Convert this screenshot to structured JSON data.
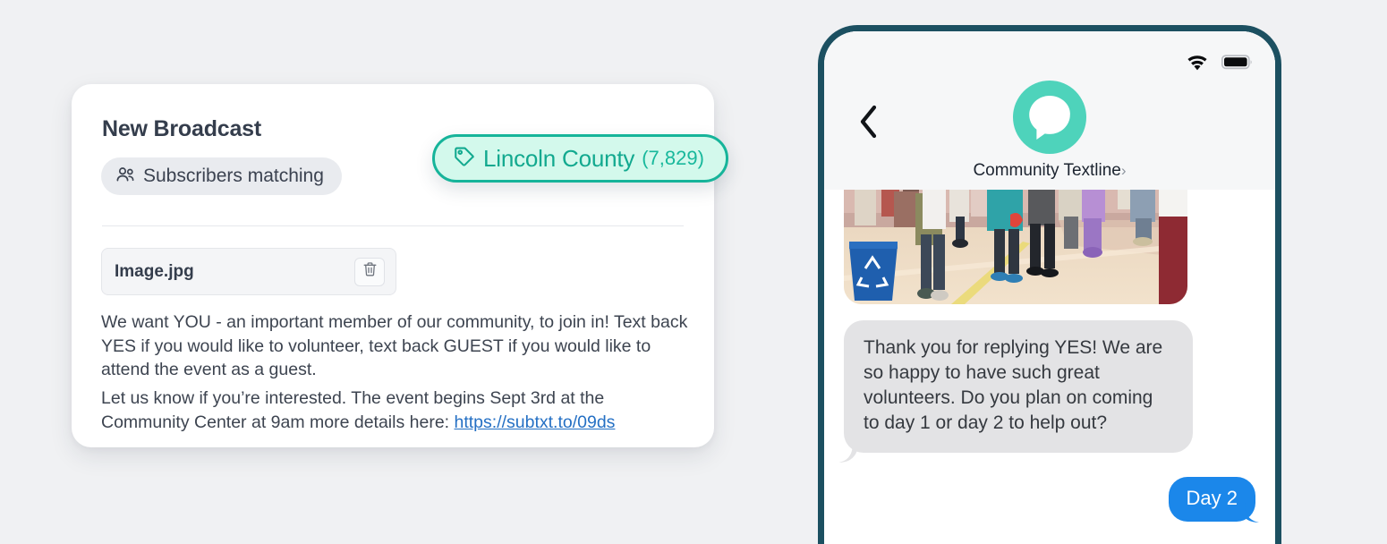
{
  "theme": {
    "page_background": "#f0f1f3",
    "accent_teal": "#16b49a",
    "phone_frame": "#1c5061",
    "imessage_blue": "#1b87ea",
    "link_blue": "#2570c4"
  },
  "broadcast": {
    "title": "New Broadcast",
    "subscribers_chip": {
      "icon": "people-group-icon",
      "label": "Subscribers matching"
    },
    "attachment": {
      "file_name": "Image.jpg",
      "delete_icon": "trash-icon"
    },
    "message_paragraphs": [
      "We want YOU - an important member of our community, to join in! Text back YES if you would like to volunteer, text back GUEST if you would like to attend the event as a guest.",
      "Let us know if you’re interested. The event begins Sept 3rd at the Community Center at 9am more details here: "
    ],
    "message_link": "https://subtxt.to/09ds"
  },
  "tag_pill": {
    "icon": "tag-icon",
    "name": "Lincoln County",
    "count": "(7,829)"
  },
  "phone": {
    "status": {
      "wifi_icon": "wifi-icon",
      "battery_icon": "battery-full-icon"
    },
    "back_icon": "chevron-left-icon",
    "avatar_icon": "speech-bubble-avatar-icon",
    "thread_name": "Community Textline",
    "thread_chevron": "›",
    "photo_alt": "community-event-photo",
    "messages": [
      {
        "direction": "incoming",
        "text": "Thank you for replying YES! We are so happy to have such great volunteers. Do you plan on coming to day 1 or day 2 to help out?"
      },
      {
        "direction": "outgoing",
        "text": "Day 2"
      }
    ]
  }
}
